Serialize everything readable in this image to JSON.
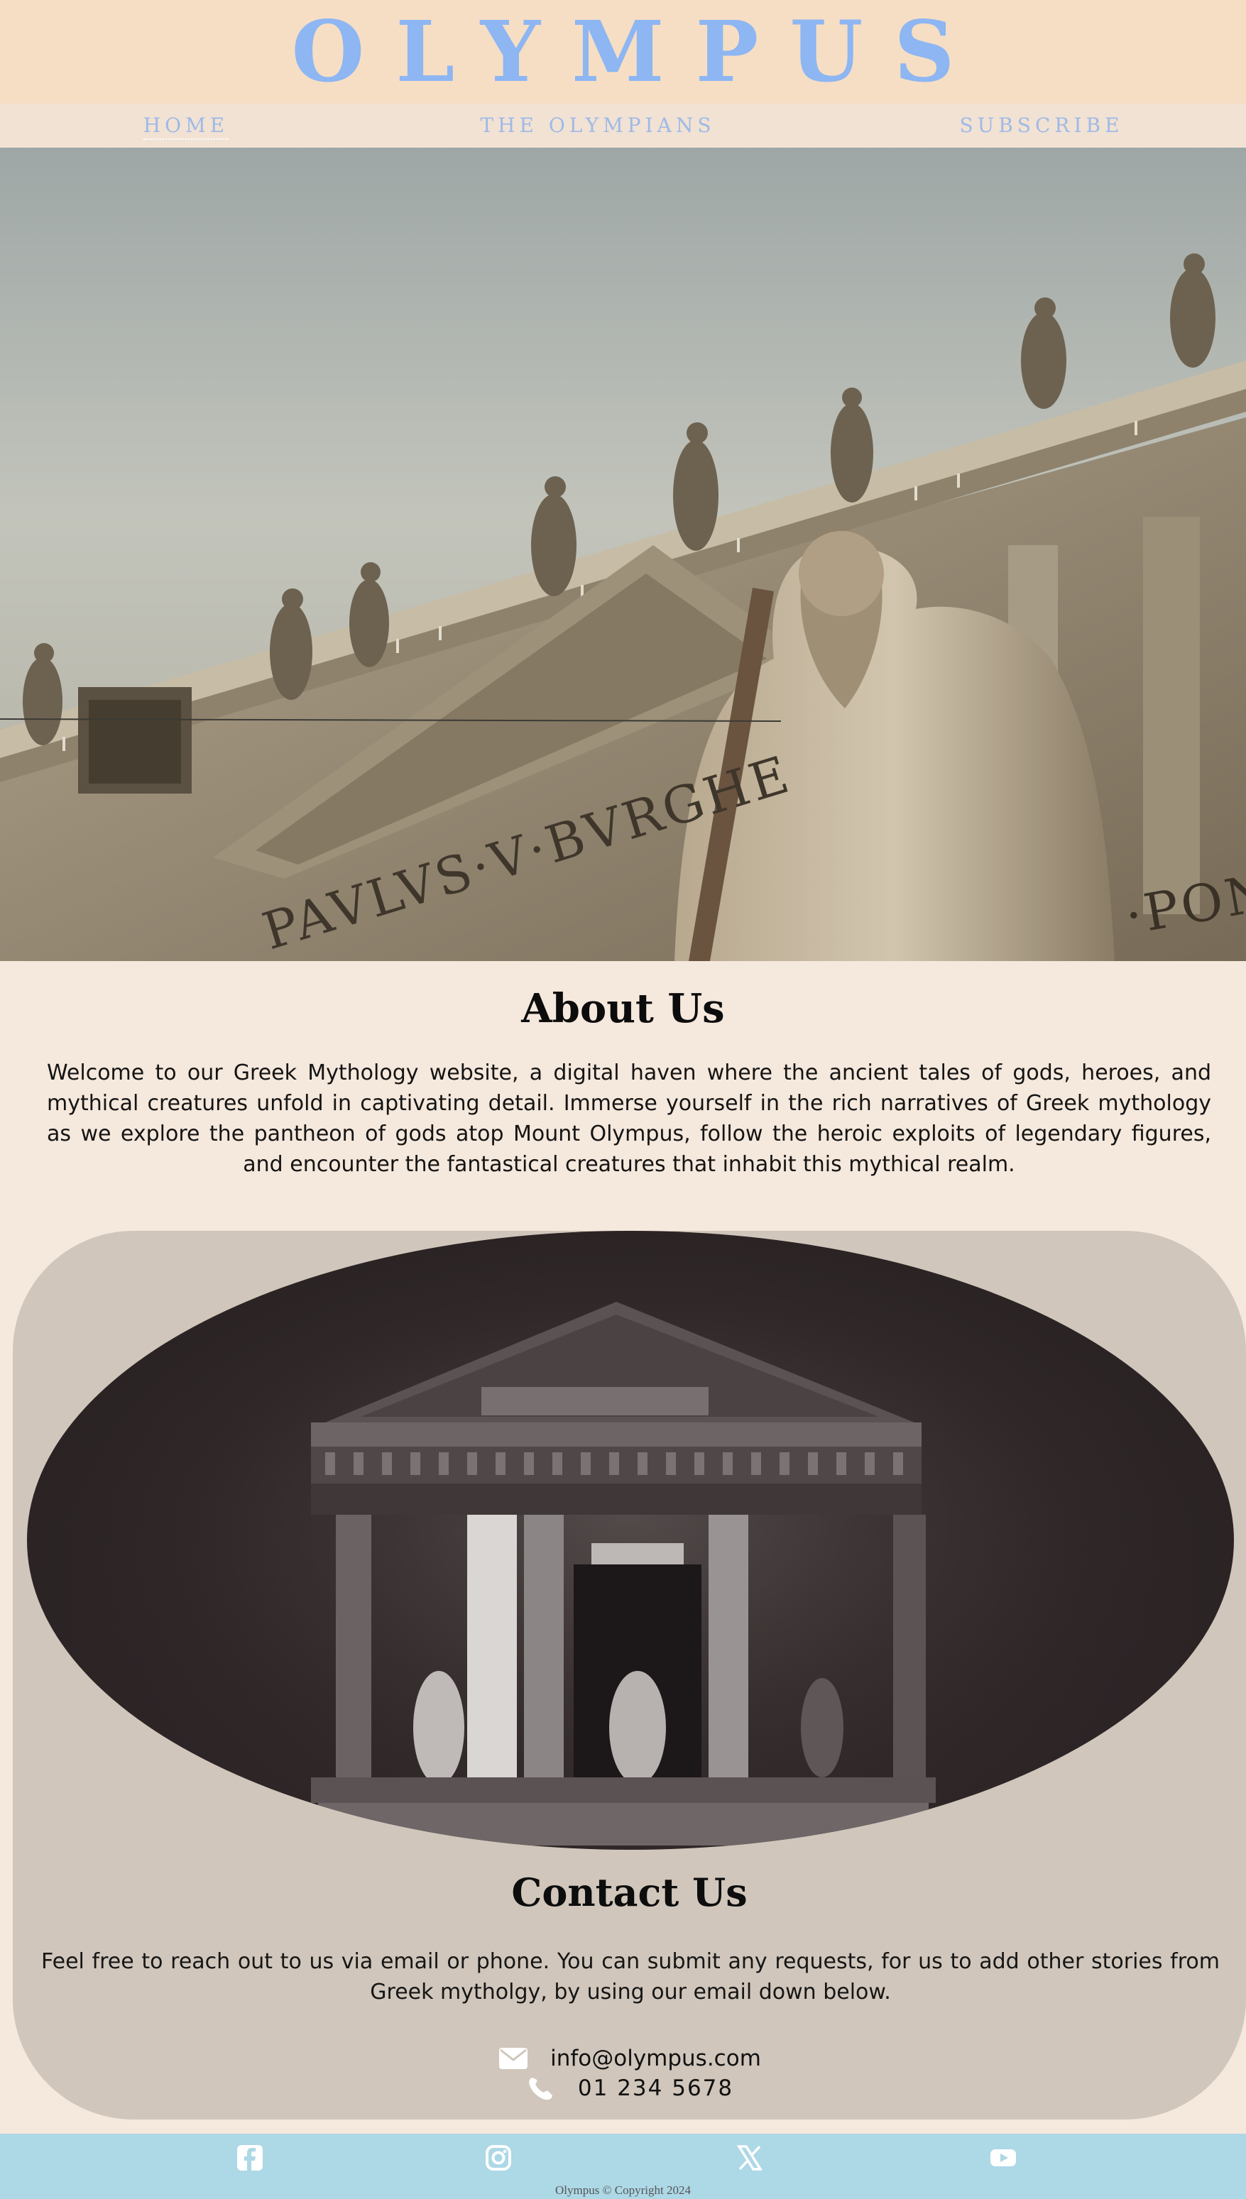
{
  "header": {
    "logo": "OLYMPUS"
  },
  "nav": {
    "items": [
      {
        "label": "HOME",
        "active": true
      },
      {
        "label": "THE OLYMPIANS",
        "active": false
      },
      {
        "label": "SUBSCRIBE",
        "active": false
      }
    ]
  },
  "hero": {
    "inscription_left": "PAVLVS·V·BVRGHE",
    "inscription_right": "·PON"
  },
  "about": {
    "title": "About Us",
    "text": "Welcome to our Greek Mythology website, a digital haven where the ancient tales of gods, heroes, and mythical creatures unfold in captivating detail. Immerse yourself in the rich narratives of Greek mythology as we explore the pantheon of gods atop Mount Olympus, follow the heroic exploits of legendary figures, and encounter the fantastical creatures that inhabit this mythical realm."
  },
  "contact": {
    "title": "Contact Us",
    "text": "Feel free to reach out to us via email or phone. You can submit any requests, for us to add other stories from Greek mytholgy, by using our email down below.",
    "email": {
      "icon": "envelope-icon",
      "value": "info@olympus.com"
    },
    "phone": {
      "icon": "phone-icon",
      "value": "01 234 5678"
    }
  },
  "footer": {
    "social": [
      "facebook-icon",
      "instagram-icon",
      "x-icon",
      "youtube-icon"
    ],
    "copyright": "Olympus © Copyright 2024"
  },
  "colors": {
    "logo": "#8db6f2",
    "nav_link": "#9fb9e7",
    "header_bg": "#f6dec5",
    "nav_bg": "#f1e2d4",
    "page_bg": "#f5e8dc",
    "card_bg": "#d0c6bb",
    "footer_bg": "#add8e6"
  }
}
